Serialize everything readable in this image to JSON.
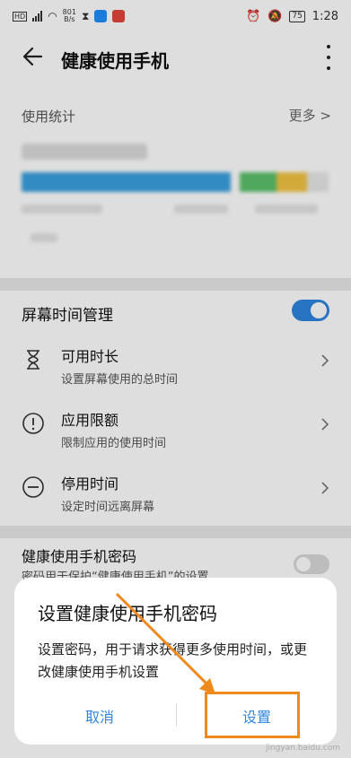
{
  "status_bar": {
    "carrier_badge": "HD",
    "net_speed_top": "801",
    "net_speed_unit": "B/s",
    "battery": "75",
    "time": "1:28"
  },
  "header": {
    "title": "健康使用手机"
  },
  "usage": {
    "label": "使用统计",
    "more": "更多"
  },
  "screen_time": {
    "label": "屏幕时间管理",
    "toggle_on": true,
    "items": [
      {
        "title": "可用时长",
        "subtitle": "设置屏幕使用的总时间",
        "icon": "hourglass-icon"
      },
      {
        "title": "应用限额",
        "subtitle": "限制应用的使用时间",
        "icon": "exclamation-circle-icon"
      },
      {
        "title": "停用时间",
        "subtitle": "设定时间远离屏幕",
        "icon": "minus-circle-icon"
      }
    ]
  },
  "password": {
    "title": "健康使用手机密码",
    "subtitle": "密码用于保护“健康使用手机”的设置"
  },
  "dialog": {
    "title": "设置健康使用手机密码",
    "body": "设置密码，用于请求获得更多使用时间，或更改健康使用手机设置",
    "cancel": "取消",
    "confirm": "设置"
  },
  "watermark": "jingyan.baidu.com",
  "colors": {
    "accent": "#2f86e0",
    "annotation": "#ef8a1a"
  }
}
